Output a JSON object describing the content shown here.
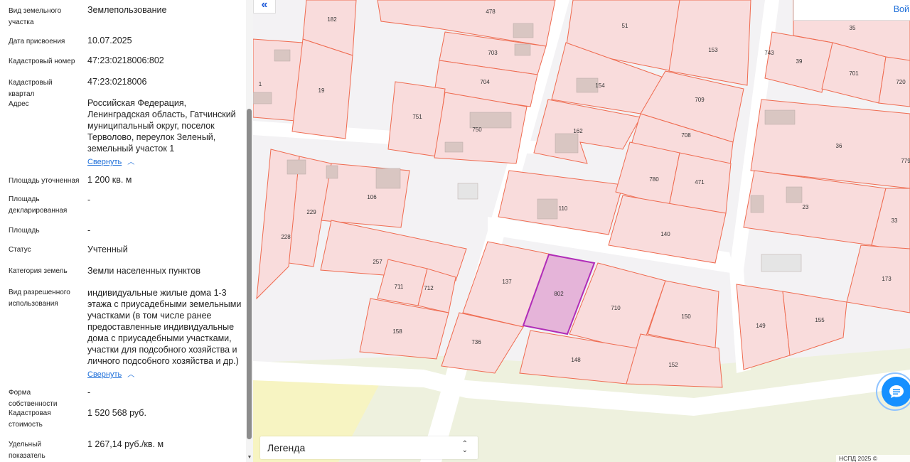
{
  "fields": [
    {
      "key": "land_type",
      "label": "Вид земельного участка",
      "value": "Землепользование"
    },
    {
      "key": "date_assigned",
      "label": "Дата присвоения",
      "value": "10.07.2025"
    },
    {
      "key": "cadastral_number",
      "label": "Кадастровый номер",
      "value": "47:23:0218006:802"
    },
    {
      "key": "cadastral_quarter",
      "label": "Кадастровый квартал",
      "value": "47:23:0218006"
    },
    {
      "key": "address",
      "label": "Адрес",
      "value": "Российская Федерация, Ленинградская область, Гатчинский муниципальный округ, поселок Терволово, переулок Зеленый, земельный участок 1",
      "toggle": "Свернуть"
    },
    {
      "key": "area_refined",
      "label": "Площадь уточненная",
      "value": "1 200 кв. м"
    },
    {
      "key": "area_declared",
      "label": "Площадь декларированная",
      "value": "-"
    },
    {
      "key": "area",
      "label": "Площадь",
      "value": "-"
    },
    {
      "key": "status",
      "label": "Статус",
      "value": "Учтенный"
    },
    {
      "key": "land_category",
      "label": "Категория земель",
      "value": "Земли населенных пунктов"
    },
    {
      "key": "permitted_use",
      "label": "Вид разрешенного использования",
      "value": "индивидуальные жилые дома 1-3 этажа с приусадебными земельными участками (в том числе ранее предоставленные индивидуальные дома с приусадебными участками, участки для подсобного хозяйства и личного подсобного хозяйства и др.)",
      "toggle": "Свернуть"
    },
    {
      "key": "ownership",
      "label": "Форма собственности",
      "value": "-"
    },
    {
      "key": "cadastral_value",
      "label": "Кадастровая стоимость",
      "value": "1 520 568 руб."
    },
    {
      "key": "specific_value",
      "label": "Удельный показатель кадастровой",
      "value": "1 267,14 руб./кв. м"
    }
  ],
  "map": {
    "selected_parcel": "802",
    "parcel_labels": [
      "182",
      "478",
      "51",
      "153",
      "743",
      "35",
      "39",
      "701",
      "720",
      "1",
      "19",
      "703",
      "704",
      "751",
      "750",
      "154",
      "709",
      "162",
      "708",
      "36",
      "779",
      "106",
      "229",
      "228",
      "110",
      "780",
      "471",
      "23",
      "33",
      "140",
      "257",
      "711",
      "712",
      "137",
      "802",
      "710",
      "150",
      "149",
      "155",
      "173",
      "158",
      "736",
      "148",
      "152"
    ],
    "colors": {
      "parcel_fill": "#f9dcdc",
      "parcel_stroke": "#ef6b50",
      "selected_fill": "#e5b4d9",
      "selected_stroke": "#b02cb8",
      "road": "#ffffff",
      "green": "#eef1de",
      "yellow": "#f7f4c2",
      "building": "#d9c6c2"
    }
  },
  "ui": {
    "collapse_icon": "double-chevron-left-icon",
    "collapse_glyph": "«",
    "login_text": "Вой",
    "legend_label": "Легенда",
    "chat_icon": "chat-icon",
    "copyright": "НСПД 2025 ©"
  }
}
